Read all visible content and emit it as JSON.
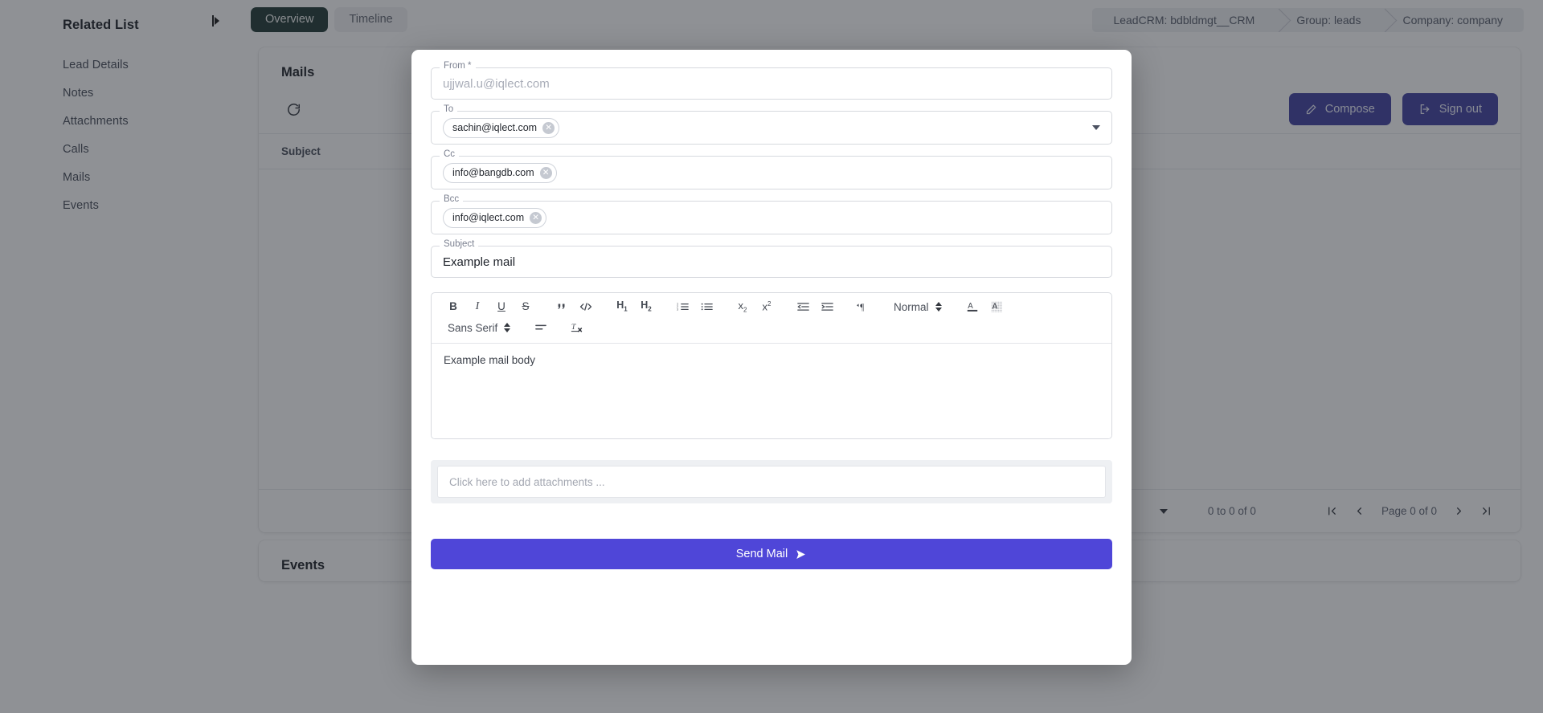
{
  "sidebar": {
    "title": "Related List",
    "collapse_icon": "collapse-panel-icon",
    "items": [
      {
        "label": "Lead Details"
      },
      {
        "label": "Notes"
      },
      {
        "label": "Attachments"
      },
      {
        "label": "Calls"
      },
      {
        "label": "Mails"
      },
      {
        "label": "Events"
      }
    ]
  },
  "topbar": {
    "tabs": [
      {
        "label": "Overview",
        "active": true
      },
      {
        "label": "Timeline",
        "active": false
      }
    ],
    "breadcrumb": [
      {
        "label": "LeadCRM: bdbldmgt__CRM"
      },
      {
        "label": "Group: leads"
      },
      {
        "label": "Company: company"
      }
    ]
  },
  "mails_card": {
    "title": "Mails",
    "refresh_icon": "refresh-icon",
    "compose_label": "Compose",
    "compose_icon": "pencil-icon",
    "signout_label": "Sign out",
    "signout_icon": "sign-out-icon",
    "column_subject": "Subject",
    "footer": {
      "page_size_icon": "chevron-down-icon",
      "range": "0 to 0 of 0",
      "first_icon": "first-page-icon",
      "prev_icon": "previous-page-icon",
      "page_label": "Page 0 of 0",
      "next_icon": "next-page-icon",
      "last_icon": "last-page-icon"
    }
  },
  "events_card": {
    "title": "Events"
  },
  "modal": {
    "from": {
      "legend": "From *",
      "placeholder": "ujjwal.u@iqlect.com",
      "value": ""
    },
    "to": {
      "legend": "To",
      "chips": [
        {
          "label": "sachin@iqlect.com"
        }
      ],
      "caret_icon": "chevron-down-icon"
    },
    "cc": {
      "legend": "Cc",
      "chips": [
        {
          "label": "info@bangdb.com"
        }
      ]
    },
    "bcc": {
      "legend": "Bcc",
      "chips": [
        {
          "label": "info@iqlect.com"
        }
      ]
    },
    "subject": {
      "legend": "Subject",
      "value": "Example mail"
    },
    "editor": {
      "toolbar_row1": [
        {
          "name": "bold-icon",
          "glyph": "B"
        },
        {
          "name": "italic-icon",
          "glyph": "I"
        },
        {
          "name": "underline-icon",
          "glyph": "U"
        },
        {
          "name": "strikethrough-icon",
          "glyph": "S"
        },
        {
          "name": "blockquote-icon",
          "glyph": "”"
        },
        {
          "name": "code-block-icon",
          "glyph": "</>"
        },
        {
          "name": "heading-1-icon",
          "glyph": "H1"
        },
        {
          "name": "heading-2-icon",
          "glyph": "H2"
        },
        {
          "name": "ordered-list-icon",
          "glyph": ""
        },
        {
          "name": "bullet-list-icon",
          "glyph": ""
        },
        {
          "name": "subscript-icon",
          "glyph": "x2"
        },
        {
          "name": "superscript-icon",
          "glyph": "x2"
        },
        {
          "name": "outdent-icon",
          "glyph": ""
        },
        {
          "name": "indent-icon",
          "glyph": ""
        },
        {
          "name": "text-direction-icon",
          "glyph": "¶"
        }
      ],
      "heading_select": {
        "value": "Normal",
        "icon": "updown-arrows-icon"
      },
      "font_select": {
        "value": "Sans Serif",
        "icon": "updown-arrows-icon"
      },
      "color_icon": "text-color-icon",
      "background_icon": "background-color-icon",
      "align_icon": "align-icon",
      "clear_format_icon": "clear-formatting-icon",
      "body_text": "Example mail body"
    },
    "attachments": {
      "placeholder": "Click here to add attachments ..."
    },
    "send": {
      "label": "Send Mail",
      "icon": "send-icon"
    }
  },
  "colors": {
    "accent_purple": "#4f46d8",
    "button_indigo": "#3a3a9e",
    "tab_active": "#17302c",
    "overlay": "rgba(40,44,52,.52)"
  }
}
